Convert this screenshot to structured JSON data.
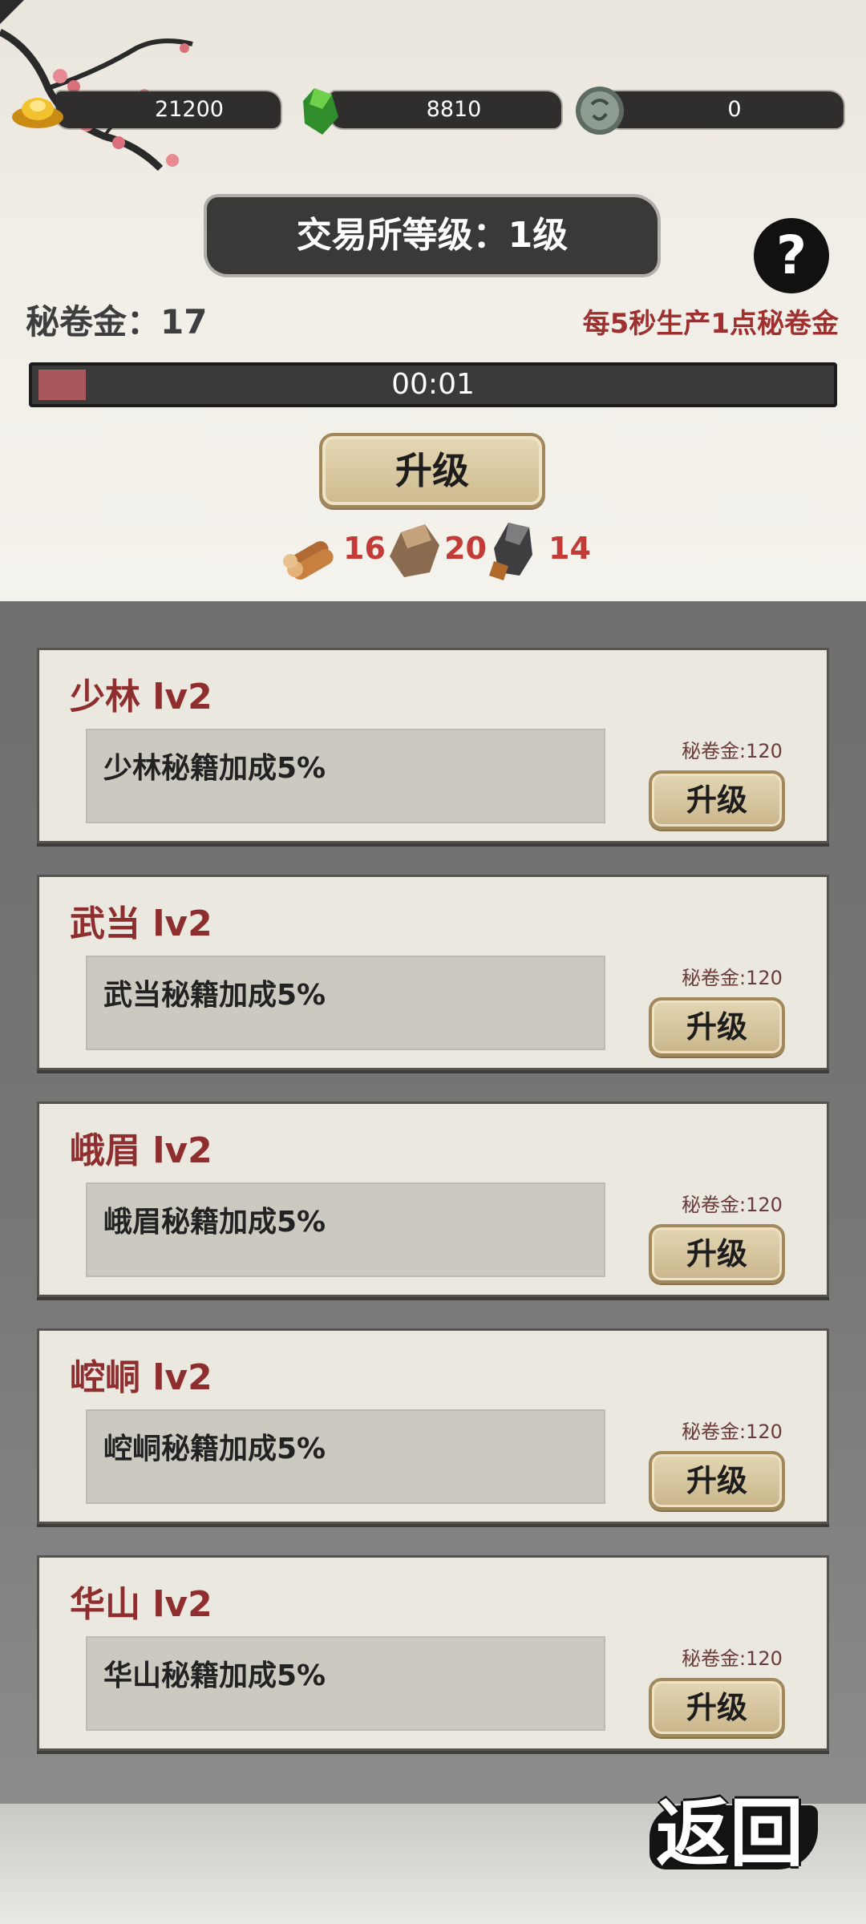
{
  "currencies": [
    {
      "name": "gold-ingot-icon",
      "value": "21200"
    },
    {
      "name": "jade-icon",
      "value": "8810"
    },
    {
      "name": "silver-coin-icon",
      "value": "0"
    }
  ],
  "exchange": {
    "level_title": "交易所等级：1级",
    "help": "?",
    "gold_label": "秘卷金：17",
    "rate_label": "每5秒生产1点秘卷金",
    "timer": "00:01",
    "progress": 0.06,
    "upgrade_label": "升级",
    "costs": [
      {
        "icon": "wood-icon",
        "value": "16"
      },
      {
        "icon": "stone-icon",
        "value": "20"
      },
      {
        "icon": "iron-ore-icon",
        "value": "14"
      }
    ]
  },
  "sects": [
    {
      "title": "少林 lv2",
      "desc": "少林秘籍加成5%",
      "cost": "秘卷金:120",
      "button": "升级"
    },
    {
      "title": "武当 lv2",
      "desc": "武当秘籍加成5%",
      "cost": "秘卷金:120",
      "button": "升级"
    },
    {
      "title": "峨眉 lv2",
      "desc": "峨眉秘籍加成5%",
      "cost": "秘卷金:120",
      "button": "升级"
    },
    {
      "title": "崆峒 lv2",
      "desc": "崆峒秘籍加成5%",
      "cost": "秘卷金:120",
      "button": "升级"
    },
    {
      "title": "华山 lv2",
      "desc": "华山秘籍加成5%",
      "cost": "秘卷金:120",
      "button": "升级"
    }
  ],
  "back_label": "返回",
  "colors": {
    "accent_red": "#9e3030",
    "cost_red": "#c23b36",
    "ink": "#3a3938"
  }
}
